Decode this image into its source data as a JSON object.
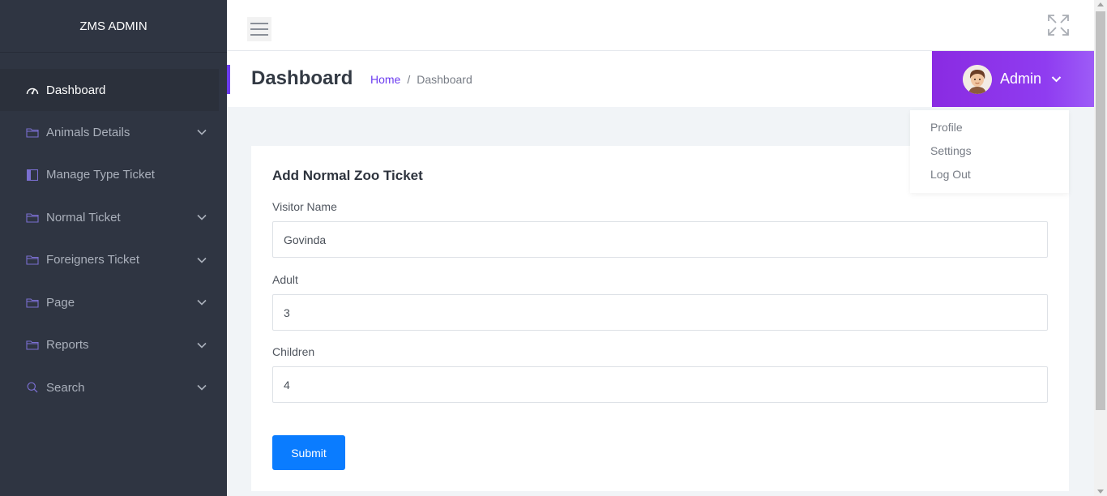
{
  "brand": {
    "title": "ZMS ADMIN"
  },
  "sidebar": {
    "items": [
      {
        "label": "Dashboard",
        "icon": "dashboard-gauge-icon",
        "active": true,
        "expandable": false
      },
      {
        "label": "Animals Details",
        "icon": "folder-icon",
        "active": false,
        "expandable": true
      },
      {
        "label": "Manage Type Ticket",
        "icon": "book-icon",
        "active": false,
        "expandable": false
      },
      {
        "label": "Normal Ticket",
        "icon": "folder-icon",
        "active": false,
        "expandable": true
      },
      {
        "label": "Foreigners Ticket",
        "icon": "folder-icon",
        "active": false,
        "expandable": true
      },
      {
        "label": "Page",
        "icon": "folder-icon",
        "active": false,
        "expandable": true
      },
      {
        "label": "Reports",
        "icon": "folder-icon",
        "active": false,
        "expandable": true
      },
      {
        "label": "Search",
        "icon": "search-icon",
        "active": false,
        "expandable": true
      }
    ]
  },
  "header": {
    "title": "Dashboard",
    "breadcrumb": {
      "home": "Home",
      "separator": "/",
      "current": "Dashboard"
    }
  },
  "user": {
    "name": "Admin",
    "menu": [
      "Profile",
      "Settings",
      "Log Out"
    ]
  },
  "form": {
    "title": "Add Normal Zoo Ticket",
    "visitor_label": "Visitor Name",
    "visitor_value": "Govinda",
    "adult_label": "Adult",
    "adult_value": "3",
    "children_label": "Children",
    "children_value": "4",
    "submit_label": "Submit"
  },
  "colors": {
    "sidebar_bg": "#2f3542",
    "accent": "#6c3cf0",
    "user_box": "#8a2be2",
    "primary_button": "#0a7cff"
  }
}
